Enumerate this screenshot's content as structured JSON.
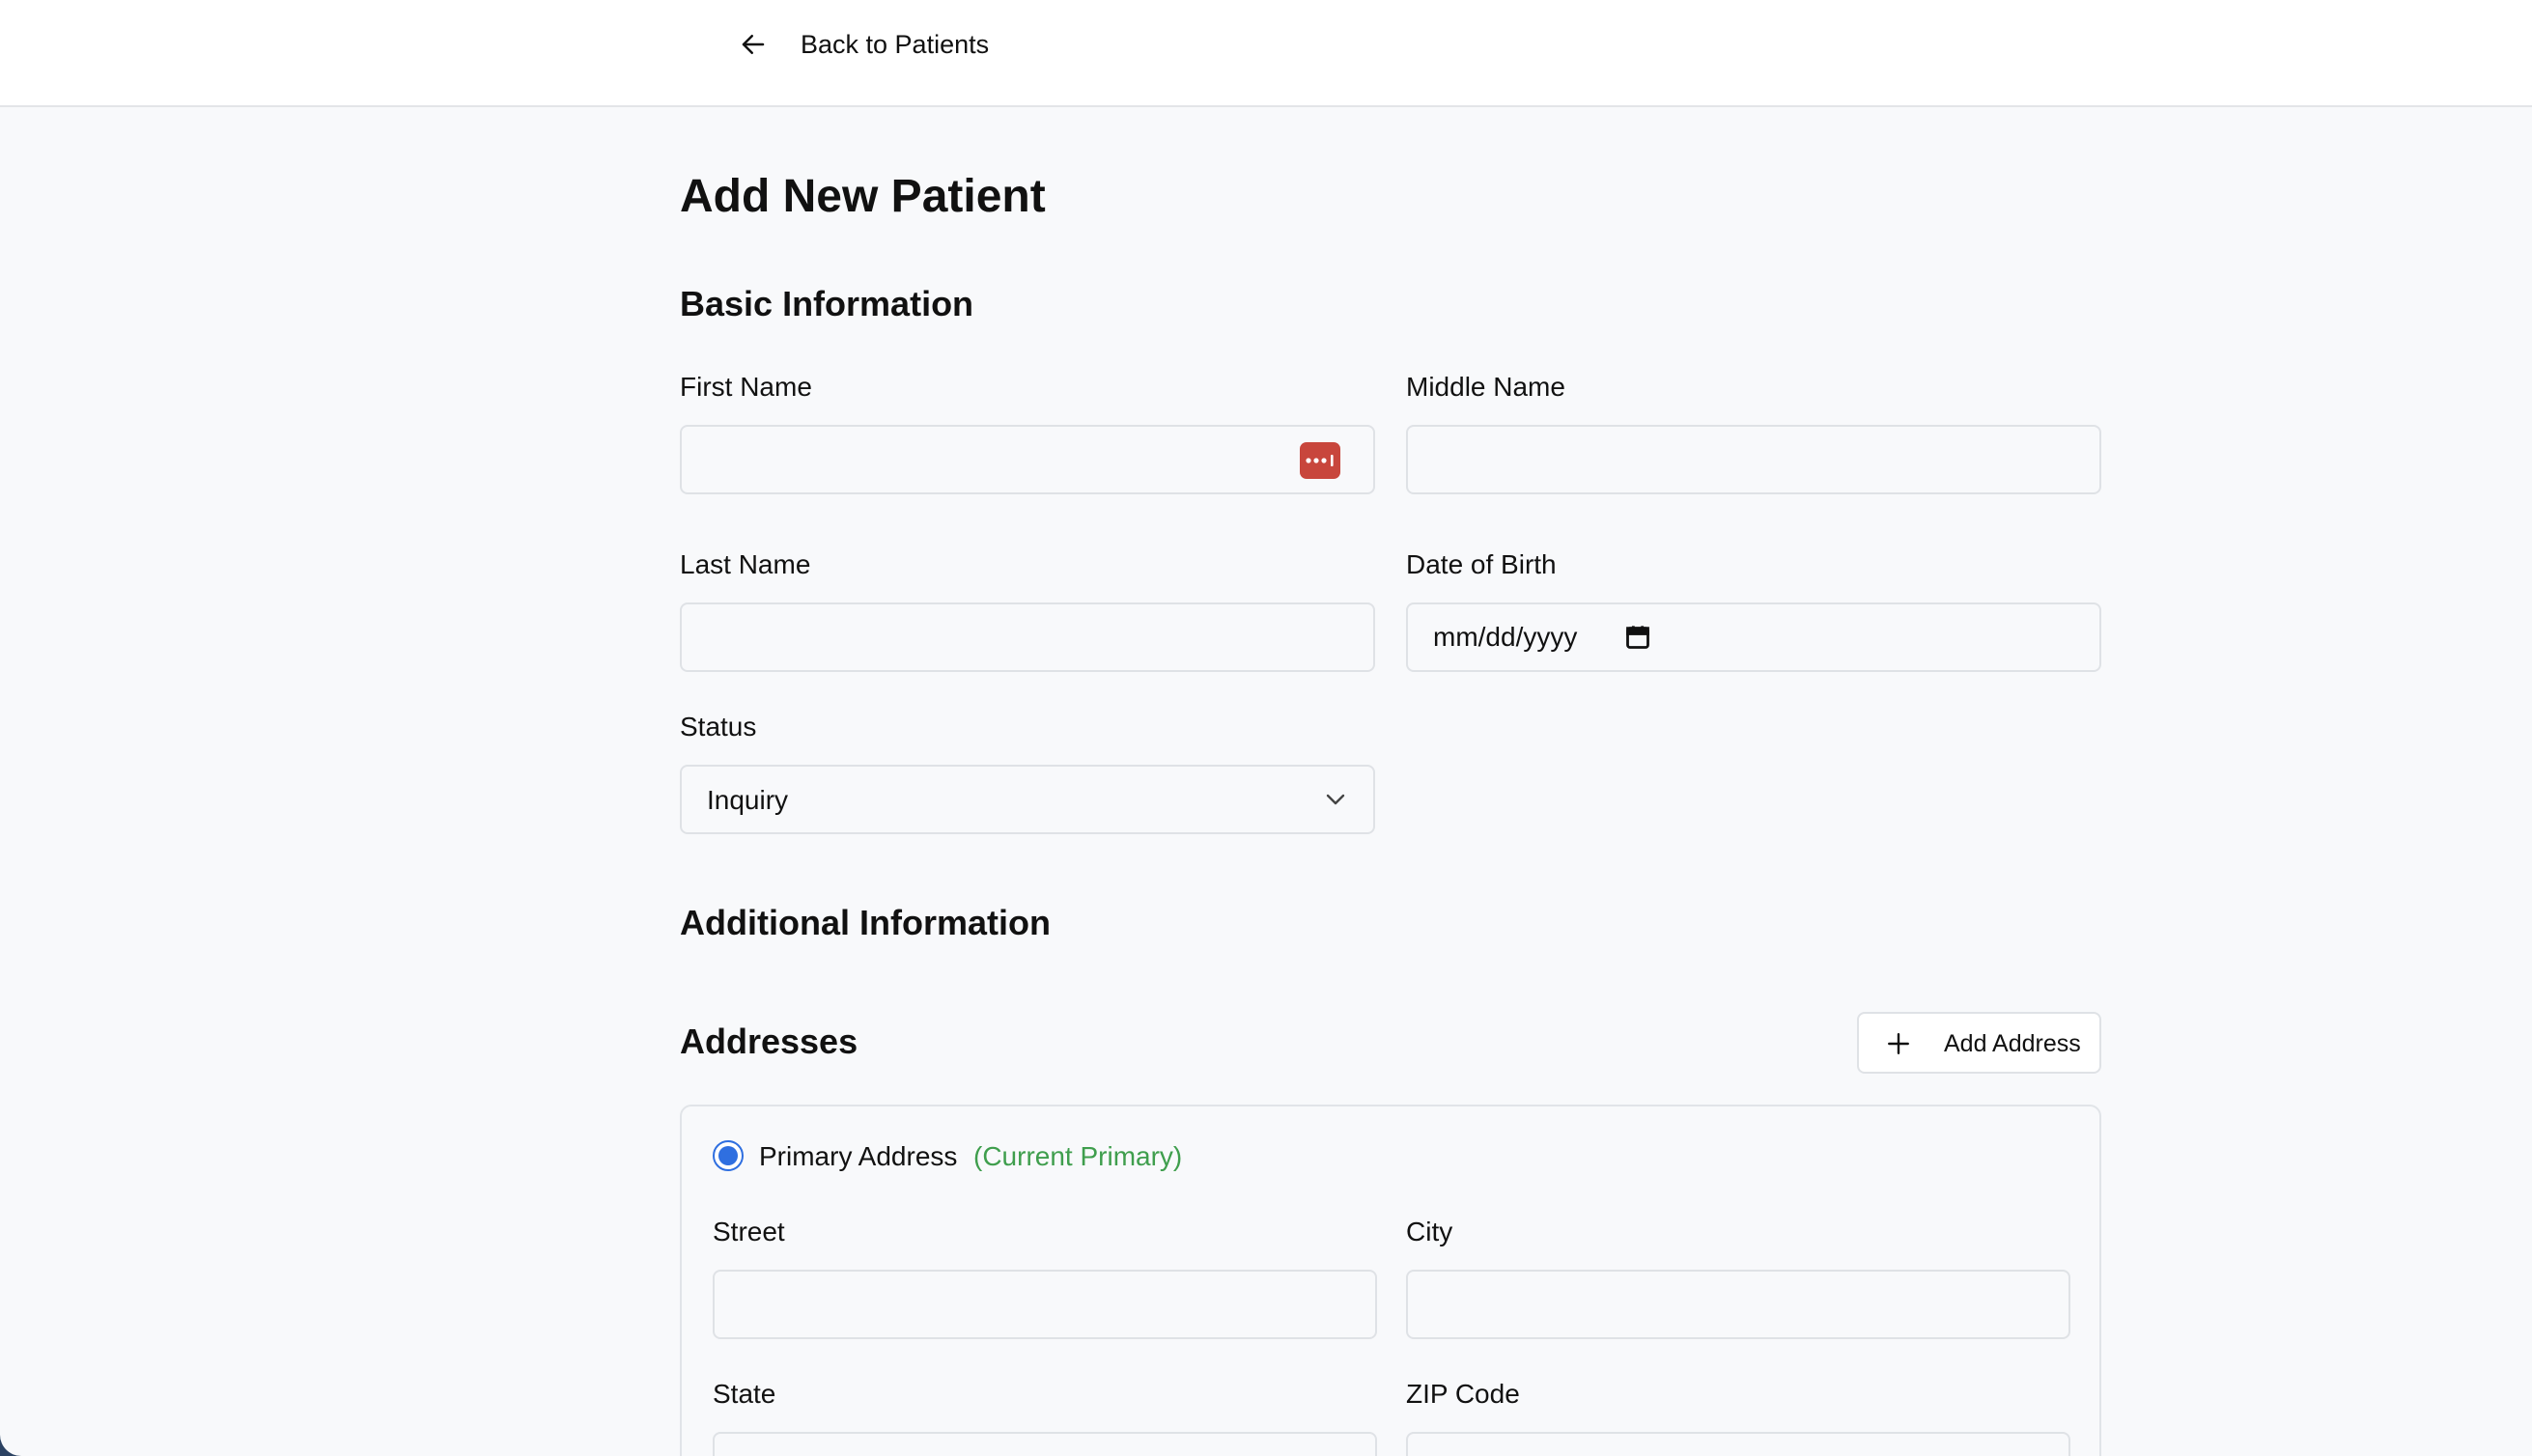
{
  "nav": {
    "back_label": "Back to Patients"
  },
  "page": {
    "title": "Add New Patient"
  },
  "basic_info": {
    "heading": "Basic Information",
    "first_name_label": "First Name",
    "middle_name_label": "Middle Name",
    "last_name_label": "Last Name",
    "dob_label": "Date of Birth",
    "dob_placeholder": "mm/dd/yyyy",
    "status_label": "Status",
    "status_value": "Inquiry"
  },
  "additional_info": {
    "heading": "Additional Information"
  },
  "addresses": {
    "heading": "Addresses",
    "add_button_label": "Add Address",
    "card": {
      "primary_label": "Primary Address",
      "current_primary_label": "(Current Primary)",
      "street_label": "Street",
      "city_label": "City",
      "state_label": "State",
      "zip_label": "ZIP Code"
    }
  },
  "icons": {
    "back": "arrow-left-icon",
    "password_manager": "password-manager-icon",
    "calendar": "calendar-icon",
    "chevron": "chevron-down-icon",
    "add": "plus-icon"
  },
  "colors": {
    "accent": "#2f6fe0",
    "success": "#3f9e4d",
    "password_manager": "#c8463c"
  }
}
